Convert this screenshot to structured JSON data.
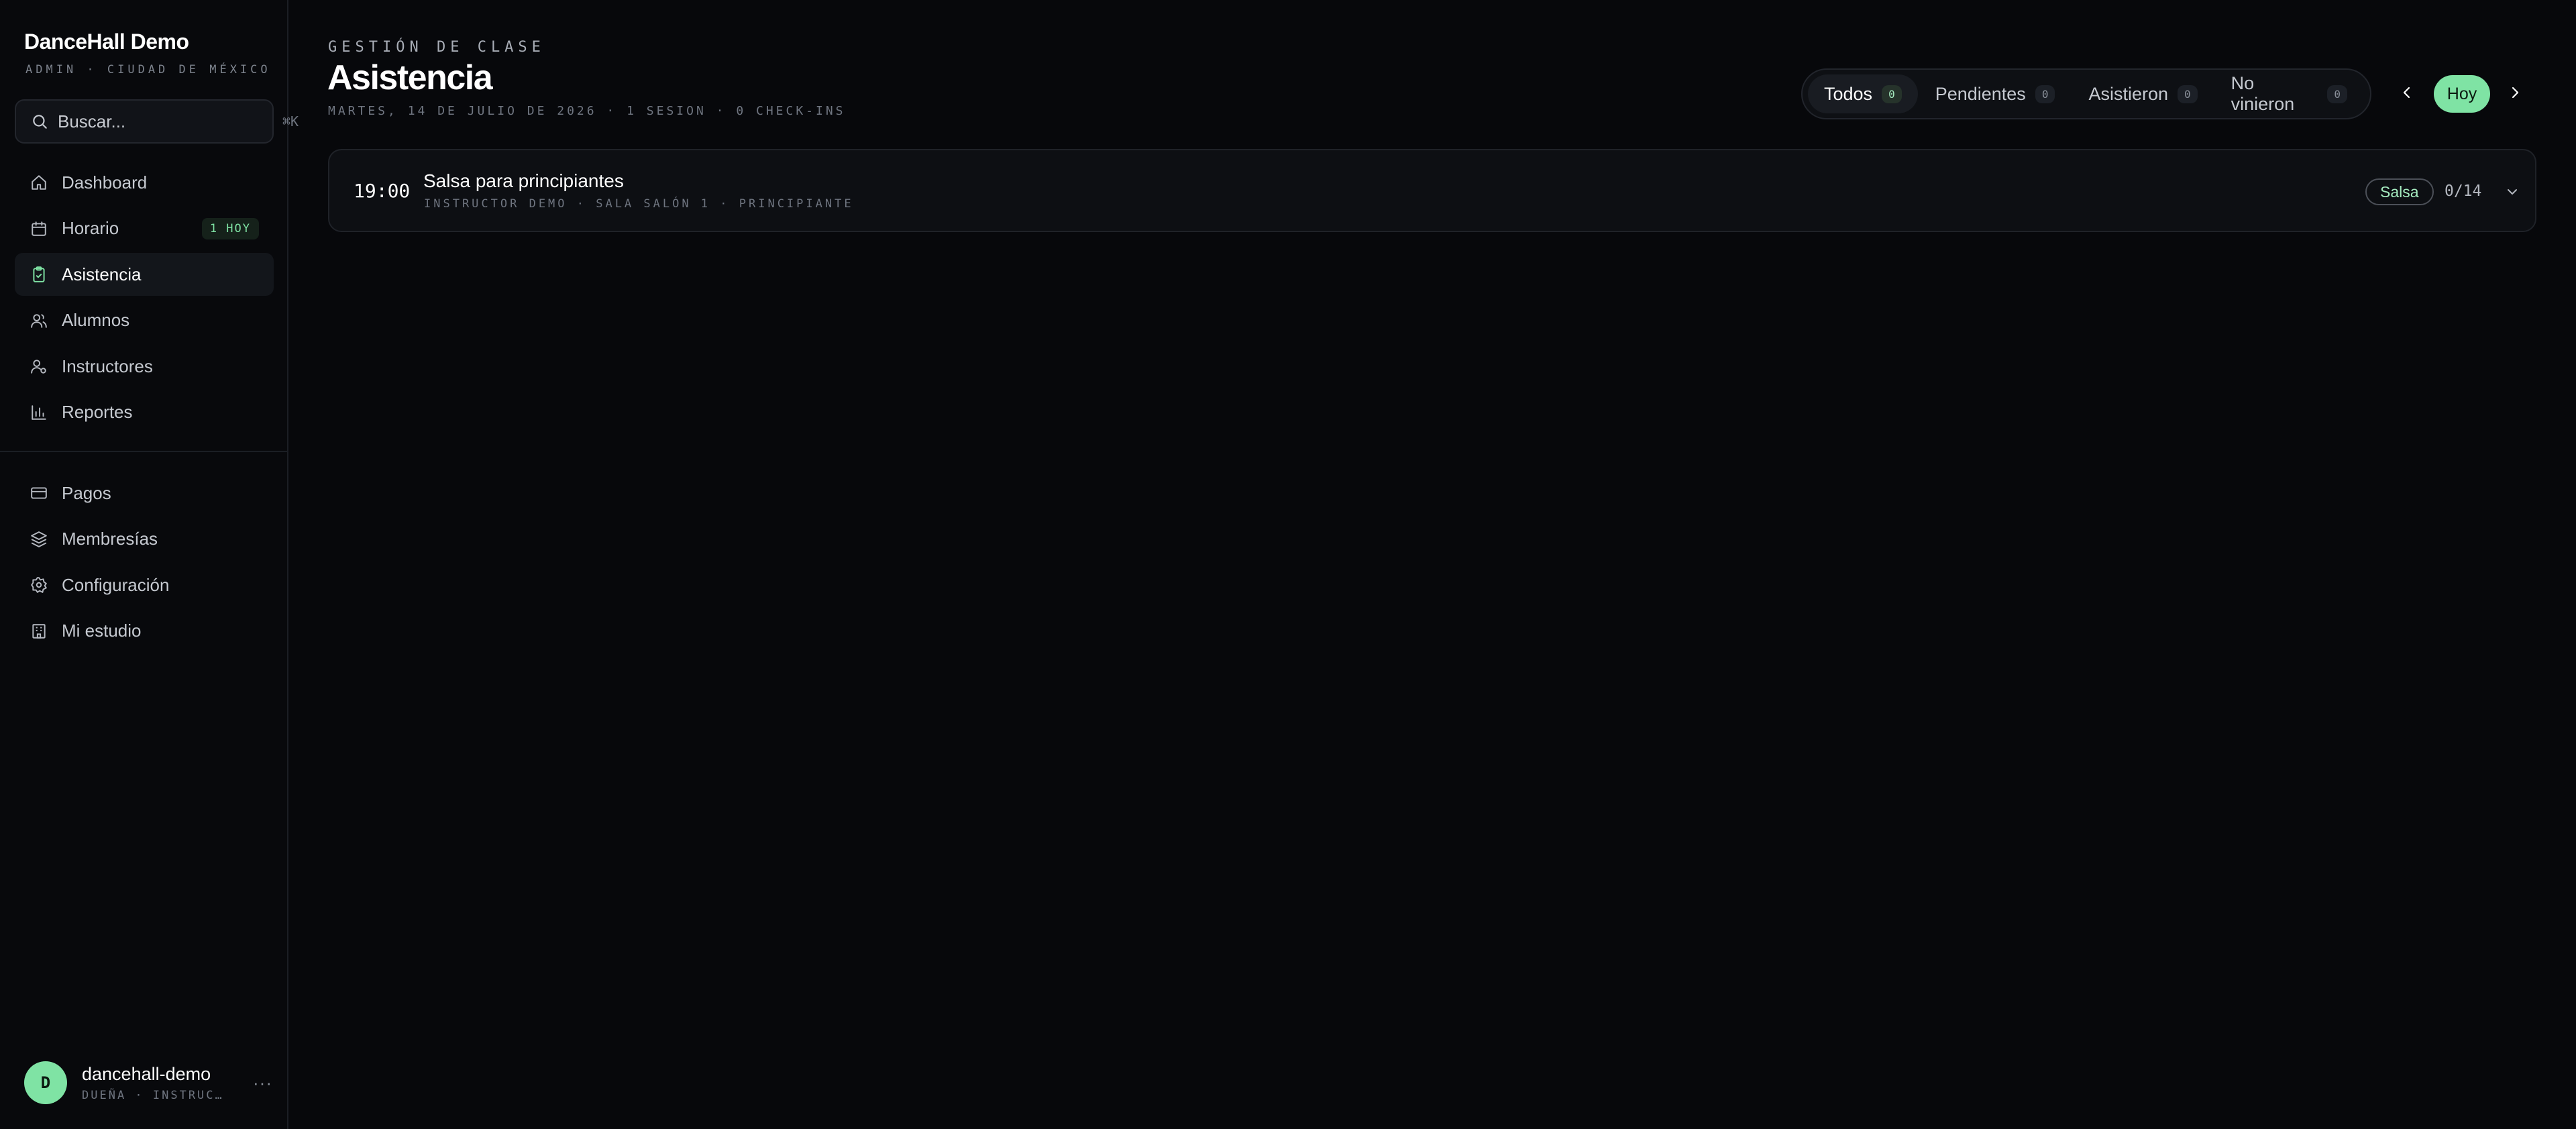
{
  "sidebar": {
    "brand_title": "DanceHall Demo",
    "brand_sub": "ADMIN · CIUDAD DE MÉXICO",
    "search": {
      "placeholder": "Buscar...",
      "shortcut": "⌘K"
    },
    "items": [
      {
        "label": "Dashboard",
        "icon": "home-icon"
      },
      {
        "label": "Horario",
        "icon": "calendar-icon",
        "badge": "1 HOY"
      },
      {
        "label": "Asistencia",
        "icon": "clipboard-check-icon",
        "active": true
      },
      {
        "label": "Alumnos",
        "icon": "users-icon"
      },
      {
        "label": "Instructores",
        "icon": "user-cog-icon"
      },
      {
        "label": "Reportes",
        "icon": "bar-chart-icon"
      }
    ],
    "secondary_items": [
      {
        "label": "Pagos",
        "icon": "credit-card-icon"
      },
      {
        "label": "Membresías",
        "icon": "layers-icon"
      },
      {
        "label": "Configuración",
        "icon": "gear-icon"
      },
      {
        "label": "Mi estudio",
        "icon": "building-icon"
      }
    ],
    "user": {
      "initial": "D",
      "name": "dancehall-demo",
      "role": "DUEÑA · INSTRUC…",
      "more": "···"
    }
  },
  "header": {
    "eyebrow": "GESTIÓN DE CLASE",
    "title": "Asistencia",
    "subtitle": "MARTES, 14 DE JULIO DE 2026 · 1 SESION · 0 CHECK-INS"
  },
  "filters": [
    {
      "label": "Todos",
      "count": "0",
      "active": true
    },
    {
      "label": "Pendientes",
      "count": "0"
    },
    {
      "label": "Asistieron",
      "count": "0"
    },
    {
      "label": "No vinieron",
      "count": "0"
    }
  ],
  "date_nav": {
    "today_label": "Hoy"
  },
  "sessions": [
    {
      "time": "19:00",
      "title": "Salsa para principiantes",
      "meta": "INSTRUCTOR DEMO · SALA SALÓN 1 · PRINCIPIANTE",
      "style": "Salsa",
      "capacity": "0/14"
    }
  ],
  "colors": {
    "background": "#07080b",
    "accent": "#7fe3a4",
    "text": "#e6e8ec"
  }
}
